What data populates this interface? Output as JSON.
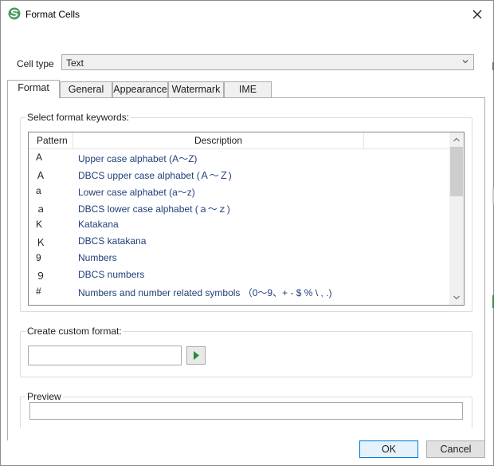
{
  "window": {
    "title": "Format Cells"
  },
  "cell_type": {
    "label": "Cell type",
    "value": "Text"
  },
  "tabs": [
    {
      "label": "Format",
      "active": true
    },
    {
      "label": "General"
    },
    {
      "label": "Appearance"
    },
    {
      "label": "Watermark"
    },
    {
      "label": "IME"
    }
  ],
  "keywords": {
    "caption": "Select format keywords:",
    "columns": [
      "Pattern",
      "Description"
    ],
    "rows": [
      {
        "pattern": "A",
        "description": "Upper case alphabet (A～Z)"
      },
      {
        "pattern": "Ａ",
        "description": "DBCS upper case alphabet (Ａ～Ｚ)"
      },
      {
        "pattern": "a",
        "description": "Lower case alphabet (a～z)"
      },
      {
        "pattern": "ａ",
        "description": "DBCS lower case alphabet (ａ～ｚ)"
      },
      {
        "pattern": "K",
        "description": "Katakana"
      },
      {
        "pattern": "Ｋ",
        "description": "DBCS katakana"
      },
      {
        "pattern": "9",
        "description": "Numbers"
      },
      {
        "pattern": "９",
        "description": "DBCS numbers"
      },
      {
        "pattern": "#",
        "description": "Numbers and number related symbols （0～9、+ - $ % \\ , .)"
      }
    ]
  },
  "custom_format": {
    "caption": "Create custom format:",
    "value": ""
  },
  "preview": {
    "caption": "Preview",
    "value": ""
  },
  "buttons": {
    "ok": "OK",
    "cancel": "Cancel"
  },
  "colors": {
    "accent": "#0078d7",
    "play": "#2a8a3a",
    "logo": "#4c9a62"
  }
}
